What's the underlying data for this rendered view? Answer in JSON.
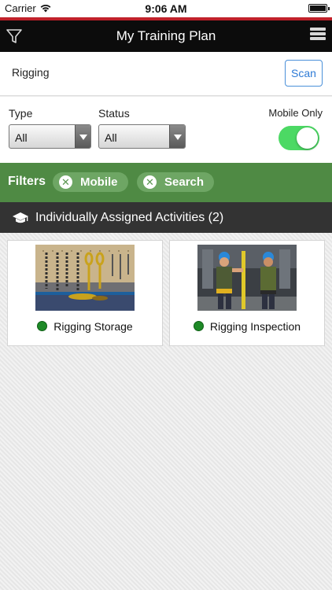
{
  "status_bar": {
    "carrier": "Carrier",
    "time": "9:06 AM",
    "battery_level": 1.0
  },
  "nav": {
    "title": "My Training Plan",
    "filter_icon": "filter-icon",
    "menu_icon": "hamburger-menu-icon"
  },
  "search": {
    "value": "Rigging",
    "scan_label": "Scan"
  },
  "filters_form": {
    "type_label": "Type",
    "type_value": "All",
    "status_label": "Status",
    "status_value": "All",
    "mobile_only_label": "Mobile Only",
    "mobile_only_on": true
  },
  "active_filters": {
    "label": "Filters",
    "chips": [
      {
        "label": "Mobile"
      },
      {
        "label": "Search"
      }
    ]
  },
  "section": {
    "title": "Individually Assigned Activities (2)",
    "icon": "graduation-cap-icon"
  },
  "activities": [
    {
      "title": "Rigging Storage",
      "status_color": "#1e8a27"
    },
    {
      "title": "Rigging Inspection",
      "status_color": "#1e8a27"
    }
  ],
  "colors": {
    "accent_red": "#c0212a",
    "filters_green": "#4f8a44",
    "toggle_green": "#4cd964",
    "scan_blue": "#2e7bd6"
  }
}
